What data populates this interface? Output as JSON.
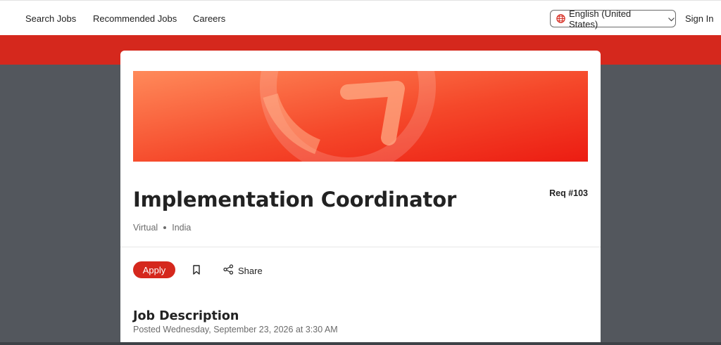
{
  "nav": {
    "links": [
      "Search Jobs",
      "Recommended Jobs",
      "Careers"
    ],
    "language": "English (United States)",
    "signin": "Sign In"
  },
  "job": {
    "title": "Implementation Coordinator",
    "req": "Req #103",
    "location_type": "Virtual",
    "location_country": "India",
    "apply_label": "Apply",
    "share_label": "Share"
  },
  "description": {
    "heading": "Job Description",
    "posted": "Posted Wednesday, September 23, 2026 at 3:30 AM"
  },
  "icons": {
    "language": "globe-icon",
    "dropdown": "chevron-down-icon",
    "bookmark": "bookmark-icon",
    "share": "share-icon"
  },
  "colors": {
    "brand_red": "#d5281d",
    "page_background": "#53575d",
    "banner_gradient_start": "#ff8a5a",
    "banner_gradient_end": "#ec1c12"
  }
}
